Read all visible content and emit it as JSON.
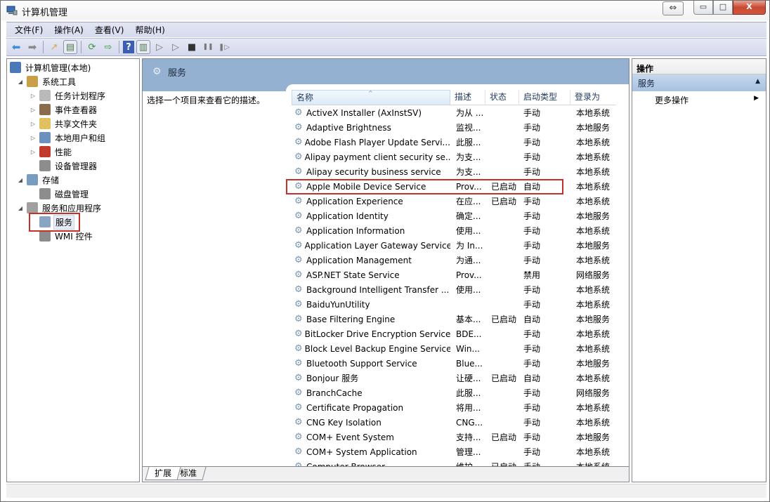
{
  "window": {
    "title": "计算机管理",
    "snap_glyph": "⇔",
    "minimize_glyph": "▭",
    "maximize_glyph": "□",
    "close_glyph": "X"
  },
  "menubar": {
    "items": [
      "文件(F)",
      "操作(A)",
      "查看(V)",
      "帮助(H)"
    ]
  },
  "toolbar": {
    "buttons": [
      {
        "name": "back-button",
        "glyph": "⬅"
      },
      {
        "name": "forward-button",
        "glyph": "➡"
      },
      {
        "name": "up-folder-button",
        "glyph": "↗"
      },
      {
        "name": "show-hide-tree-button",
        "glyph": "▤"
      },
      {
        "name": "refresh-button",
        "glyph": "⟳"
      },
      {
        "name": "export-list-button",
        "glyph": "⇨"
      },
      {
        "name": "help-button",
        "glyph": "?"
      },
      {
        "name": "show-hide-action-pane-button",
        "glyph": "▥"
      },
      {
        "name": "start-service-button",
        "glyph": "▷"
      },
      {
        "name": "start-service-alt-button",
        "glyph": "▷"
      },
      {
        "name": "stop-service-button",
        "glyph": "■"
      },
      {
        "name": "pause-service-button",
        "glyph": "❚❚"
      },
      {
        "name": "restart-service-button",
        "glyph": "❚▷"
      }
    ]
  },
  "tree": {
    "items": [
      {
        "label": "计算机管理(本地)",
        "level": 0,
        "expander": "",
        "icon": "computer-management-icon",
        "color": "#4a78b8"
      },
      {
        "label": "系统工具",
        "level": 1,
        "expander": "◢",
        "icon": "system-tools-icon",
        "color": "#c9a04a"
      },
      {
        "label": "任务计划程序",
        "level": 2,
        "expander": "▷",
        "icon": "task-scheduler-icon",
        "color": "#b9b9b9"
      },
      {
        "label": "事件查看器",
        "level": 2,
        "expander": "▷",
        "icon": "event-viewer-icon",
        "color": "#8a6d4a"
      },
      {
        "label": "共享文件夹",
        "level": 2,
        "expander": "▷",
        "icon": "shared-folders-icon",
        "color": "#e0c060"
      },
      {
        "label": "本地用户和组",
        "level": 2,
        "expander": "▷",
        "icon": "local-users-groups-icon",
        "color": "#6a8fc0"
      },
      {
        "label": "性能",
        "level": 2,
        "expander": "▷",
        "icon": "performance-icon",
        "color": "#c0392b"
      },
      {
        "label": "设备管理器",
        "level": 2,
        "expander": "",
        "icon": "device-manager-icon",
        "color": "#8d8d8d"
      },
      {
        "label": "存储",
        "level": 1,
        "expander": "◢",
        "icon": "storage-icon",
        "color": "#7a9cc0"
      },
      {
        "label": "磁盘管理",
        "level": 2,
        "expander": "",
        "icon": "disk-management-icon",
        "color": "#8d8d8d"
      },
      {
        "label": "服务和应用程序",
        "level": 1,
        "expander": "◢",
        "icon": "services-applications-icon",
        "color": "#a0a0a0"
      },
      {
        "label": "服务",
        "level": 2,
        "expander": "",
        "icon": "services-gear-icon",
        "color": "#8aa4c4",
        "selected": true
      },
      {
        "label": "WMI 控件",
        "level": 2,
        "expander": "",
        "icon": "wmi-control-icon",
        "color": "#8d8d8d"
      }
    ]
  },
  "center": {
    "header_title": "服务",
    "header_icon": "services-gear-icon",
    "description_prompt": "选择一个项目来查看它的描述。",
    "columns": {
      "name": "名称",
      "description": "描述",
      "status": "状态",
      "startup_type": "启动类型",
      "log_on_as": "登录为"
    },
    "sort_indicator": "^",
    "services": [
      {
        "name": "ActiveX Installer (AxInstSV)",
        "desc": "为从 ...",
        "status": "",
        "startup": "手动",
        "logon": "本地系统"
      },
      {
        "name": "Adaptive Brightness",
        "desc": "监视...",
        "status": "",
        "startup": "手动",
        "logon": "本地服务"
      },
      {
        "name": "Adobe Flash Player Update Servi...",
        "desc": "此服...",
        "status": "",
        "startup": "手动",
        "logon": "本地系统"
      },
      {
        "name": "Alipay payment client security se...",
        "desc": "为支...",
        "status": "",
        "startup": "手动",
        "logon": "本地系统"
      },
      {
        "name": "Alipay security business service",
        "desc": "为支...",
        "status": "",
        "startup": "手动",
        "logon": "本地系统"
      },
      {
        "name": "Apple Mobile Device Service",
        "desc": "Prov...",
        "status": "已启动",
        "startup": "自动",
        "logon": "本地系统",
        "highlighted": true
      },
      {
        "name": "Application Experience",
        "desc": "在应...",
        "status": "已启动",
        "startup": "手动",
        "logon": "本地系统"
      },
      {
        "name": "Application Identity",
        "desc": "确定...",
        "status": "",
        "startup": "手动",
        "logon": "本地服务"
      },
      {
        "name": "Application Information",
        "desc": "使用...",
        "status": "",
        "startup": "手动",
        "logon": "本地系统"
      },
      {
        "name": "Application Layer Gateway Service",
        "desc": "为 In...",
        "status": "",
        "startup": "手动",
        "logon": "本地服务"
      },
      {
        "name": "Application Management",
        "desc": "为通...",
        "status": "",
        "startup": "手动",
        "logon": "本地系统"
      },
      {
        "name": "ASP.NET State Service",
        "desc": "Prov...",
        "status": "",
        "startup": "禁用",
        "logon": "网络服务"
      },
      {
        "name": "Background Intelligent Transfer ...",
        "desc": "使用...",
        "status": "",
        "startup": "手动",
        "logon": "本地系统"
      },
      {
        "name": "BaiduYunUtility",
        "desc": "",
        "status": "",
        "startup": "手动",
        "logon": "本地系统"
      },
      {
        "name": "Base Filtering Engine",
        "desc": "基本...",
        "status": "已启动",
        "startup": "自动",
        "logon": "本地服务"
      },
      {
        "name": "BitLocker Drive Encryption Service",
        "desc": "BDE...",
        "status": "",
        "startup": "手动",
        "logon": "本地系统"
      },
      {
        "name": "Block Level Backup Engine Service",
        "desc": "Win...",
        "status": "",
        "startup": "手动",
        "logon": "本地系统"
      },
      {
        "name": "Bluetooth Support Service",
        "desc": "Blue...",
        "status": "",
        "startup": "手动",
        "logon": "本地服务"
      },
      {
        "name": "Bonjour 服务",
        "desc": "让硬...",
        "status": "已启动",
        "startup": "自动",
        "logon": "本地系统"
      },
      {
        "name": "BranchCache",
        "desc": "此服...",
        "status": "",
        "startup": "手动",
        "logon": "网络服务"
      },
      {
        "name": "Certificate Propagation",
        "desc": "将用...",
        "status": "",
        "startup": "手动",
        "logon": "本地系统"
      },
      {
        "name": "CNG Key Isolation",
        "desc": "CNG...",
        "status": "",
        "startup": "手动",
        "logon": "本地系统"
      },
      {
        "name": "COM+ Event System",
        "desc": "支持...",
        "status": "已启动",
        "startup": "手动",
        "logon": "本地服务"
      },
      {
        "name": "COM+ System Application",
        "desc": "管理...",
        "status": "",
        "startup": "手动",
        "logon": "本地系统"
      },
      {
        "name": "Computer Browser",
        "desc": "维护...",
        "status": "已启动",
        "startup": "手动",
        "logon": "本地系统"
      }
    ],
    "tabs": [
      "扩展",
      "标准"
    ],
    "scroll_up_glyph": "▲",
    "scroll_down_glyph": "▼",
    "scroll_grip_glyph": "≡"
  },
  "actions": {
    "header": "操作",
    "section_title": "服务",
    "section_collapse_glyph": "▲",
    "items": [
      {
        "label": "更多操作",
        "arrow": "▶"
      }
    ]
  },
  "colors": {
    "highlight_border": "#c4312b",
    "header_blue": "#94b1d2",
    "menubar_bg": "#d6dbee"
  }
}
